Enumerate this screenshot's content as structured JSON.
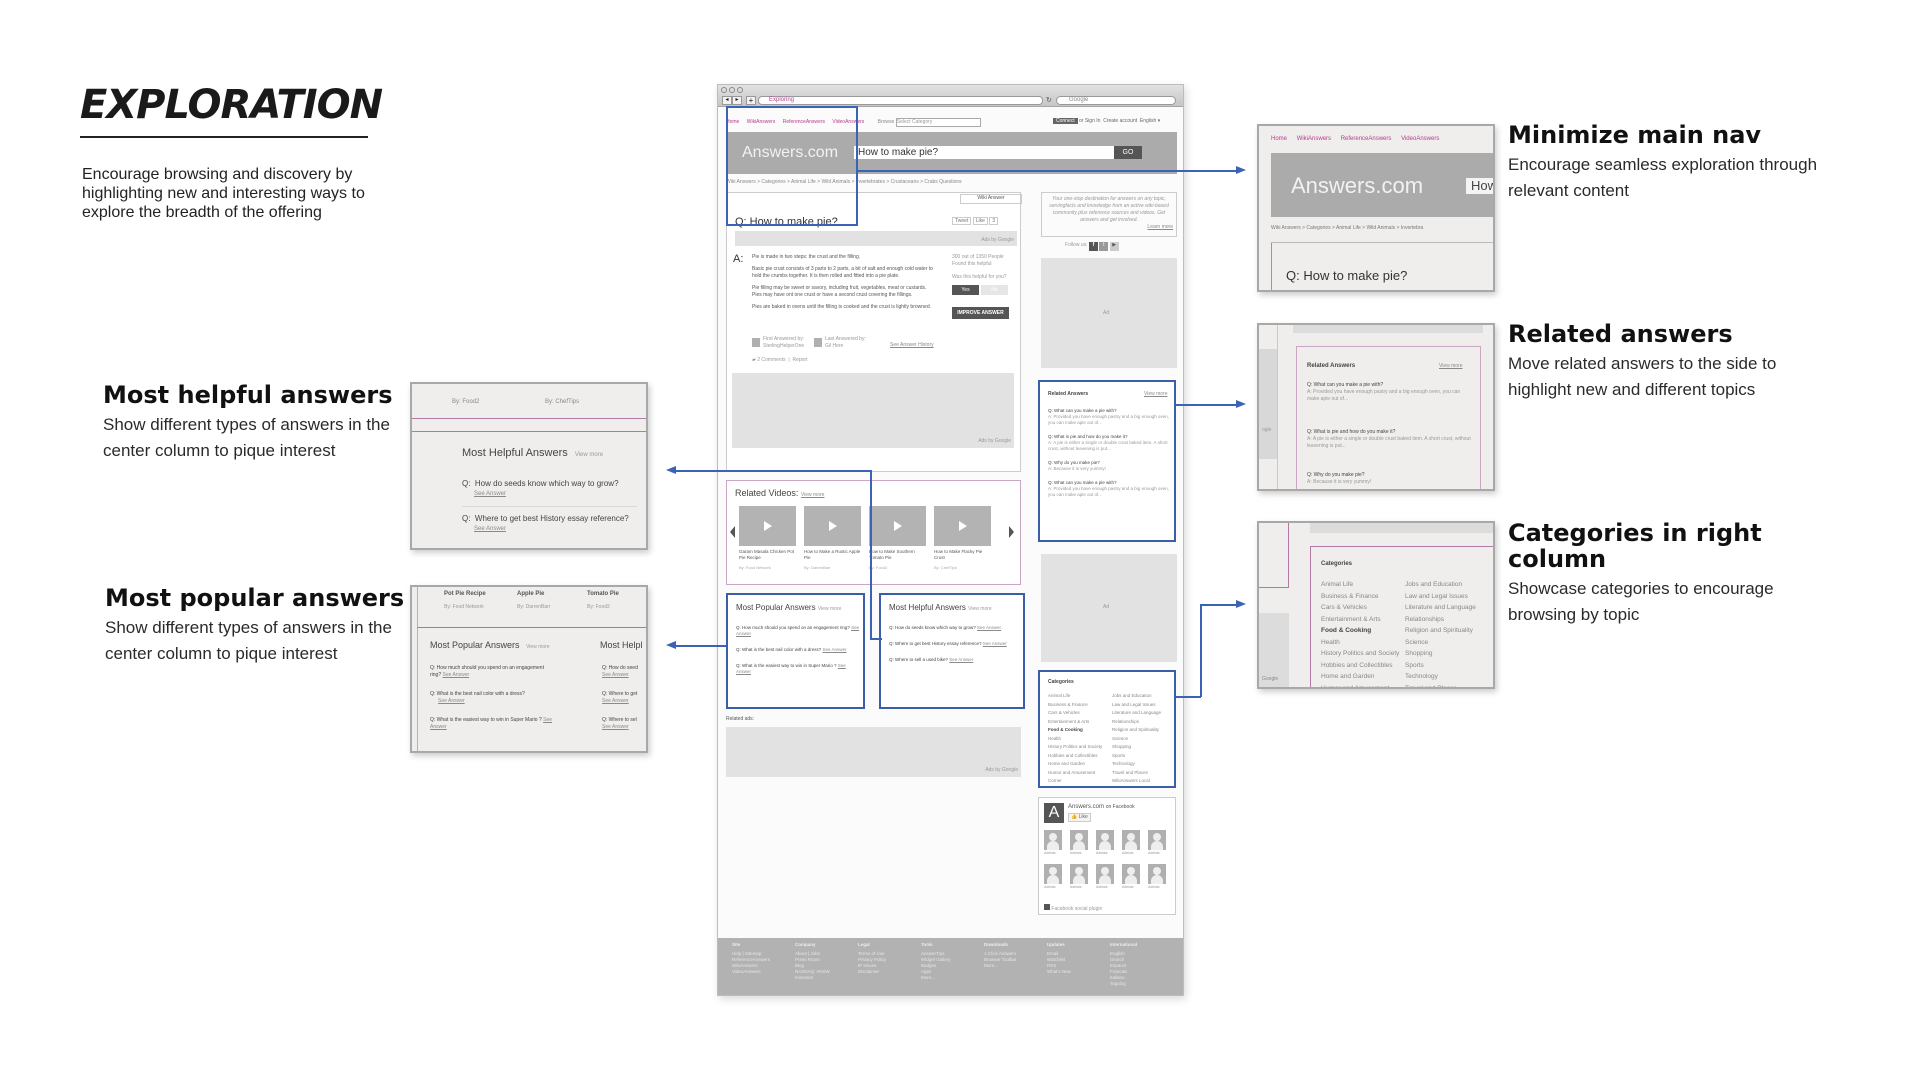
{
  "intro": {
    "title": "EXPLORATION",
    "description": "Encourage browsing and discovery by highlighting new and interesting ways to explore the breadth of the offering"
  },
  "callouts": {
    "main_nav": {
      "heading": "Minimize main nav",
      "body": "Encourage seamless exploration through relevant content"
    },
    "related": {
      "heading": "Related answers",
      "body": "Move related answers to the side to highlight new and different topics"
    },
    "categories": {
      "heading": "Categories in right column",
      "body": "Showcase categories to encourage browsing by topic"
    },
    "helpful": {
      "heading": "Most helpful answers",
      "body": "Show different types of answers in the center column to pique interest"
    },
    "popular": {
      "heading": "Most popular answers",
      "body": "Show different types of answers in the center column to pique interest"
    }
  },
  "browser": {
    "tab_title": "Exploring",
    "search_engine": "Google",
    "nav": [
      "Home",
      "WikiAnswers",
      "ReferenceAnswers",
      "VideoAnswers"
    ],
    "browse_label": "Browse",
    "browse_select": "Select Category",
    "connect_label": "Connect",
    "sign_in": "or Sign In",
    "create_account": "Create account",
    "language": "English ▾",
    "logo": "Answers.com",
    "search_value": "How to make pie?",
    "go_label": "GO",
    "breadcrumb": "Wiki Answers > Categories > Animal Life > Wild Animals > Invertebrates > Crustaceans > Crabs Questions",
    "breadcrumb_short": "Wiki Answers > Categories > Animal Life > Wild Animals > Invertebra",
    "wiki_tab": "Wiki Answer",
    "question": "Q: How to make pie?",
    "tweet": "Tweet",
    "like": "Like",
    "like_count": "3",
    "ads_by_google": "Ads by Google",
    "answer_label": "A:",
    "answer_paragraphs": [
      "Pie is made in two steps: the crust and the filling.",
      "Basic pie crust consists of 3 parts to 2 parts, a bit of salt and enough cold water to hold the crumbs together. It is then rolled and fitted into a pie plate.",
      "Pie filling may be sweet or savory, including fruit, vegetables, meat or custards. Pies may have ont one crust or have a second crust covering the fillings.",
      "Pies are baked in ovens until the filling is cooked and the crust is lightly browned."
    ],
    "helpful_stat": "300 out of 1350 People Found this helpful",
    "helpful_q": "Was this helpful for you?",
    "yes": "Yes",
    "no": "No",
    "improve": "IMPROVE ANSWER",
    "first_answered": "First Answered by:",
    "first_user": "SterlingHelperOne",
    "last_answered": "Last Answered by:",
    "last_user": "Gil Here",
    "history_link": "See Answer History",
    "comments": "2 Comments",
    "report": "Report",
    "related_videos": "Related Videos:",
    "view_more": "View more",
    "videos": [
      {
        "title": "Garam Masala Chicken Pot Pie Recipe",
        "by": "By: Food Network"
      },
      {
        "title": "How to Make a Rustic Apple Pie",
        "by": "By: DarrenBarr"
      },
      {
        "title": "How to Make Southern Tomato Pie",
        "by": "By: Food2"
      },
      {
        "title": "How to Make Flacky Pie Crust",
        "by": "By: ChefTips"
      }
    ],
    "popular_title": "Most Popular Answers",
    "popular": [
      "How much should you spend on an engagement ring?",
      "What is the best nail color with a dress?",
      "What is the easiest way to win in Super Mario ?"
    ],
    "helpful_title": "Most Helpful Answers",
    "helpful": [
      "How do seeds know which way to grow?",
      "Where to get best History essay reference?",
      "Where to sell a used bike?"
    ],
    "see_answer": "See Answer",
    "related_ads": "Related ads:",
    "promo": "Your one-stop destination for answers on any topic, servingfacts and knowledge from an active wiki-based community plus reference sources and videos. Get answers and get involved.",
    "learn_more": "Learn more",
    "follow_us": "Follow us:",
    "ad_label": "Ad",
    "related_title": "Related Answers",
    "related": [
      {
        "q": "What can you make a pie with?",
        "a": "Provided you have enough pastry and a big enough oven, you can make apie out of..."
      },
      {
        "q": "What is pie and how do you make it?",
        "a": "A pie is either a single or double crust baked item. A short crust, without leavening is put..."
      },
      {
        "q": "Why do you make pie?",
        "a": "Because it is very yummy!"
      },
      {
        "q": "What can you make a pie with?",
        "a": "Provided you have enough pastry and a big enough oven, you can make apie out of..."
      }
    ],
    "categories_title": "Categories",
    "categories_left": [
      "Animal Life",
      "Business & Finance",
      "Cars & Vehicles",
      "Entertainment & Arts",
      "Food & Cooking",
      "Health",
      "History Politics and Society",
      "Hobbies and Collectibles",
      "Home and Garden",
      "Humor and Amusement",
      "Corner"
    ],
    "categories_right": [
      "Jobs and Education",
      "Law and Legal Issues",
      "Literature and Language",
      "Relationships",
      "Religion and Spirituality",
      "Science",
      "Shopping",
      "Sports",
      "Technology",
      "Travel and Places",
      "WikiAnswers Local"
    ],
    "fb_name": "Answers.com",
    "fb_on": "on Facebook",
    "fb_like": "Like",
    "fb_fan": "Adelais",
    "fb_plugin": "Facebook social plugin",
    "footer": [
      {
        "head": "Site",
        "items": [
          "Help | Sitemap",
          "ReferenceAnswers",
          "WikiAnswers",
          "VideoAnswers"
        ]
      },
      {
        "head": "Company",
        "items": [
          "About | Jobs",
          "Press Room",
          "Blog",
          "NASDAQ: ANSW",
          "Investors"
        ]
      },
      {
        "head": "Legal",
        "items": [
          "Terms of Use",
          "Privacy Policy",
          "IP Issues",
          "Disclaimer"
        ]
      },
      {
        "head": "Tools",
        "items": [
          "AnswerTips",
          "Widget Gallery",
          "Badges",
          "Apps",
          "More..."
        ]
      },
      {
        "head": "Downloads",
        "items": [
          "1-Click Answers",
          "Browser Toolbar",
          "More..."
        ]
      },
      {
        "head": "Updates",
        "items": [
          "Email",
          "Watchlist",
          "RSS",
          "What's New"
        ]
      },
      {
        "head": "International",
        "items": [
          "English",
          "Deutch",
          "Espanol",
          "Francais",
          "Italiano",
          "Tagalog"
        ]
      }
    ]
  },
  "detail_helpful": {
    "top_by": [
      "By: Food2",
      "By: ChefTips"
    ]
  },
  "detail_popular": {
    "top_titles": [
      "Pot Pie Recipe",
      "Apple Pie",
      "Tomato Pie"
    ],
    "top_by": [
      "By: Food Network",
      "By: DarrenBarr",
      "By: Food2"
    ],
    "cut_title": "Most Helpl"
  },
  "colors": {
    "accent_blue": "#3b5ea8",
    "nav_pink": "#b43c8e",
    "mock_grey": "#a9a9a9"
  }
}
